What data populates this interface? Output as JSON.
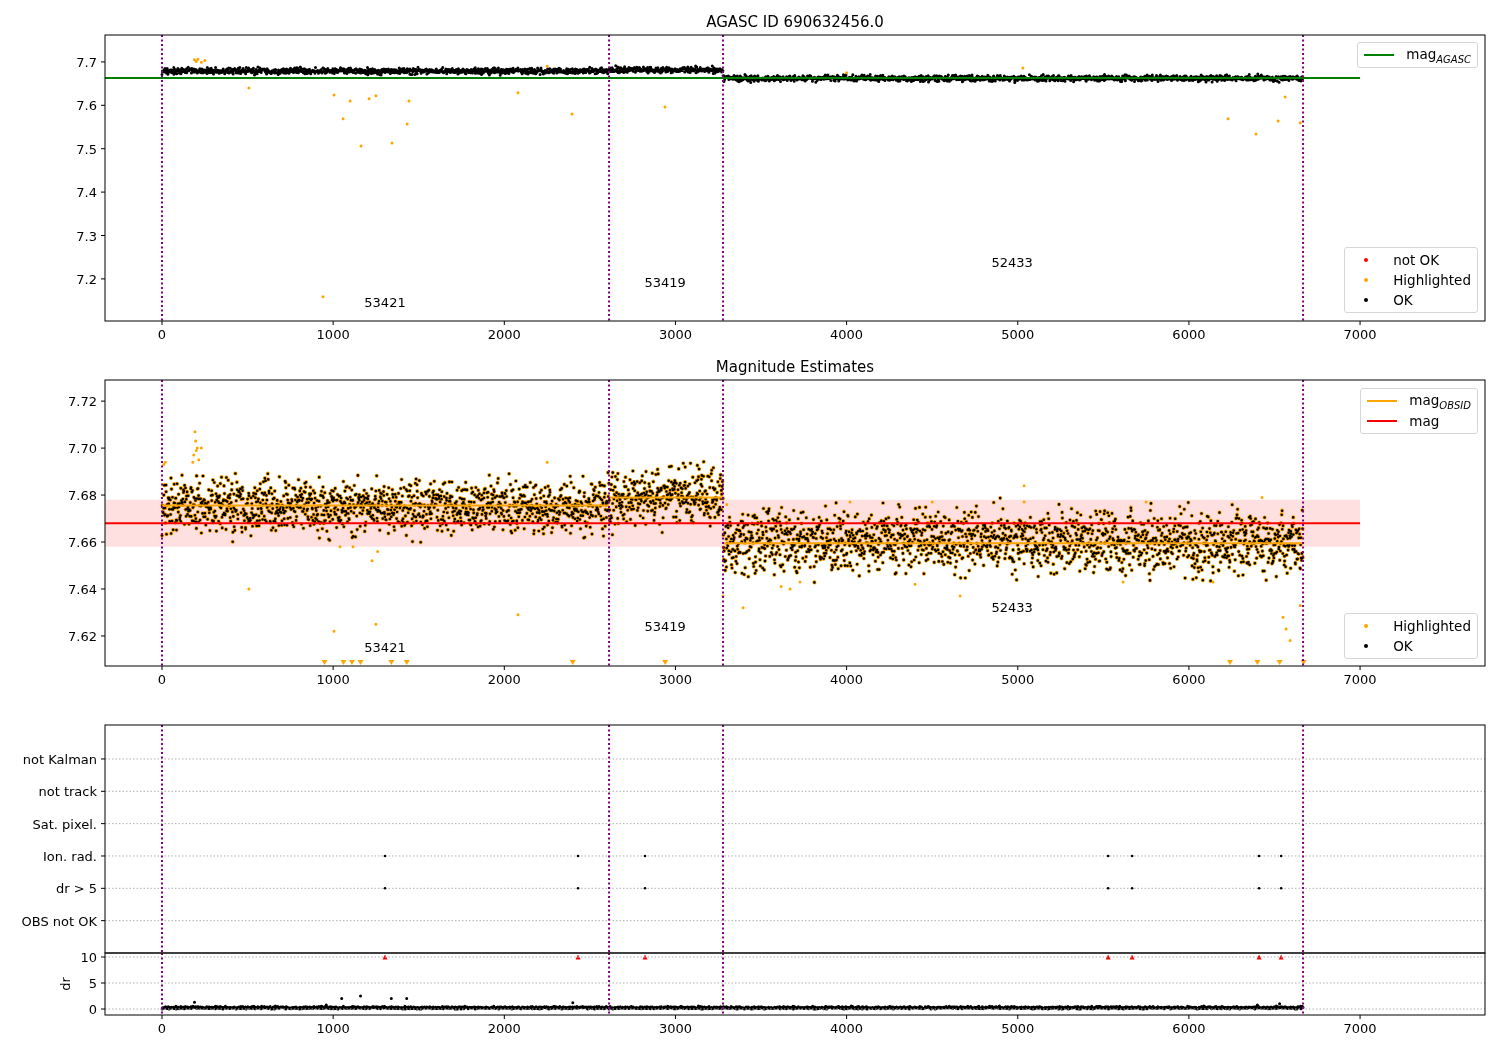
{
  "panels": [
    {
      "chart_data": {
        "type": "scatter",
        "title": "AGASC ID 690632456.0",
        "xlim": [
          -333,
          7730
        ],
        "ylim": [
          7.103,
          7.762
        ],
        "xticks": [
          0,
          1000,
          2000,
          3000,
          4000,
          5000,
          6000,
          7000
        ],
        "yticks": [
          7.2,
          7.3,
          7.4,
          7.5,
          7.6,
          7.7
        ],
        "series": [
          {
            "type": "line",
            "color": "#008000",
            "x": [
              -333,
              7000
            ],
            "values": [
              7.663,
              7.663
            ]
          }
        ],
        "ref_lines": [
          {
            "axis": "x",
            "value": 0,
            "color": "#800080"
          },
          {
            "axis": "x",
            "value": 2612,
            "color": "#800080"
          },
          {
            "axis": "x",
            "value": 3278,
            "color": "#800080"
          },
          {
            "axis": "x",
            "value": 6667,
            "color": "#800080"
          }
        ],
        "annotations": [
          "53421",
          "53419",
          "52433"
        ]
      },
      "legends": [
        {
          "items": [
            {
              "label": "mag$_{AGASC}$",
              "kind": "line",
              "color": "#008000"
            }
          ]
        },
        {
          "items": [
            {
              "label": "not OK",
              "kind": "dot",
              "color": "#ff0000"
            },
            {
              "label": "Highlighted",
              "kind": "dot",
              "color": "#ffa500"
            },
            {
              "label": "OK",
              "kind": "dot",
              "color": "#000000"
            }
          ]
        }
      ]
    },
    {
      "chart_data": {
        "type": "scatter",
        "title": "Magnitude Estimates",
        "xlim": [
          -333,
          7730
        ],
        "ylim": [
          7.6072,
          7.729
        ],
        "xticks": [
          0,
          1000,
          2000,
          3000,
          4000,
          5000,
          6000,
          7000
        ],
        "yticks": [
          7.62,
          7.64,
          7.66,
          7.68,
          {
            "value": 7.7,
            "label": "7.70"
          },
          7.72
        ],
        "series": [
          {
            "type": "line",
            "color": "#ff0000",
            "x": [
              -333,
              7000
            ],
            "values": [
              7.668,
              7.668
            ]
          },
          {
            "type": "line",
            "color": "#ffa500",
            "x": [
              0,
              2612
            ],
            "values": [
              7.6755,
              7.6755
            ]
          },
          {
            "type": "line",
            "color": "#ffa500",
            "x": [
              2612,
              3278
            ],
            "values": [
              7.679,
              7.679
            ]
          },
          {
            "type": "line",
            "color": "#ffa500",
            "x": [
              3278,
              6667
            ],
            "values": [
              7.6595,
              7.6595
            ]
          },
          {
            "type": "scatter",
            "color": "#ffa500",
            "x": [
              950,
              1060,
              1110,
              1160,
              1340,
              1430,
              2400,
              2940,
              6240,
              6400,
              6530,
              6670
            ],
            "values": [
              7.6085,
              7.6085,
              7.6085,
              7.6085,
              7.6085,
              7.6085,
              7.6085,
              7.6085,
              7.6085,
              7.6085,
              7.6085,
              7.6085
            ]
          }
        ],
        "bands": [
          {
            "axis": "y",
            "from": 7.658,
            "to": 7.678,
            "color": "#ff0000"
          }
        ],
        "ref_lines": [
          {
            "axis": "x",
            "value": 0,
            "color": "#800080"
          },
          {
            "axis": "x",
            "value": 2612,
            "color": "#800080"
          },
          {
            "axis": "x",
            "value": 3278,
            "color": "#800080"
          },
          {
            "axis": "x",
            "value": 6667,
            "color": "#800080"
          }
        ],
        "annotations": [
          "53421",
          "53419",
          "52433"
        ]
      },
      "legends": [
        {
          "items": [
            {
              "label": "mag$_{OBSID}$",
              "kind": "line",
              "color": "#ffa500"
            },
            {
              "label": "mag",
              "kind": "line",
              "color": "#ff0000"
            }
          ]
        },
        {
          "items": [
            {
              "label": "Highlighted",
              "kind": "dot",
              "color": "#ffa500"
            },
            {
              "label": "OK",
              "kind": "dot",
              "color": "#000000"
            }
          ]
        }
      ]
    },
    {
      "flag_labels": [
        "not Kalman",
        "not track",
        "Sat. pixel.",
        "Ion. rad.",
        "dr > 5",
        "OBS not OK"
      ]
    },
    {
      "chart_data": {
        "type": "scatter",
        "ylabel": "dr",
        "grid": true,
        "xlim": [
          -333,
          7730
        ],
        "ylim": [
          -1.15,
          10.77
        ],
        "xticks": [
          0,
          1000,
          2000,
          3000,
          4000,
          5000,
          6000,
          7000
        ],
        "yticks": [
          0,
          5,
          10
        ],
        "series": [
          {
            "type": "scatter",
            "color": "#ff0000",
            "x": [
              1303,
              2431,
              2822,
              5528,
              5668,
              6410,
              6539
            ],
            "values": [
              10,
              10,
              10,
              10,
              10,
              10,
              10
            ]
          }
        ],
        "ref_lines": [
          {
            "axis": "x",
            "value": 0,
            "color": "#800080"
          },
          {
            "axis": "x",
            "value": 2612,
            "color": "#800080"
          },
          {
            "axis": "x",
            "value": 3278,
            "color": "#800080"
          },
          {
            "axis": "x",
            "value": 6667,
            "color": "#800080"
          }
        ]
      }
    }
  ]
}
